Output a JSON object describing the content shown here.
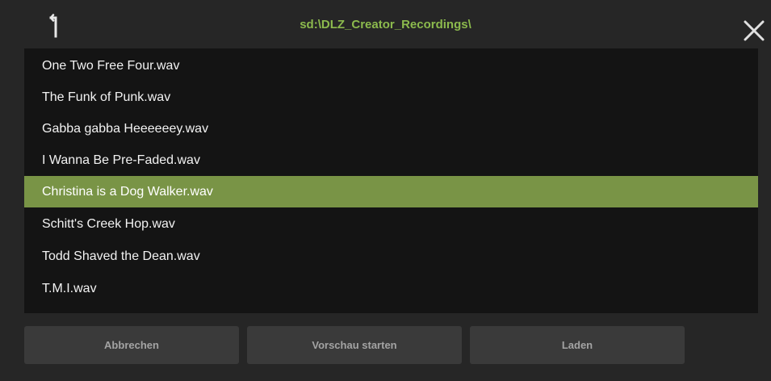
{
  "header": {
    "path": "sd:\\DLZ_Creator_Recordings\\",
    "up_icon": "arrow-up-icon",
    "close_icon": "close-icon"
  },
  "files": [
    {
      "name": "One Two Free Four.wav",
      "selected": false
    },
    {
      "name": "The Funk of Punk.wav",
      "selected": false
    },
    {
      "name": "Gabba gabba Heeeeeey.wav",
      "selected": false
    },
    {
      "name": "I Wanna Be Pre-Faded.wav",
      "selected": false
    },
    {
      "name": "Christina is a Dog Walker.wav",
      "selected": true
    },
    {
      "name": "Schitt's Creek Hop.wav",
      "selected": false
    },
    {
      "name": "Todd Shaved the Dean.wav",
      "selected": false
    },
    {
      "name": "T.M.I.wav",
      "selected": false
    }
  ],
  "buttons": {
    "cancel": "Abbrechen",
    "preview": "Vorschau starten",
    "load": "Laden"
  },
  "colors": {
    "accent": "#8cba4d",
    "selected_row": "#799446",
    "background": "#262626",
    "list_background": "#141414",
    "button": "#3a3a3a"
  }
}
